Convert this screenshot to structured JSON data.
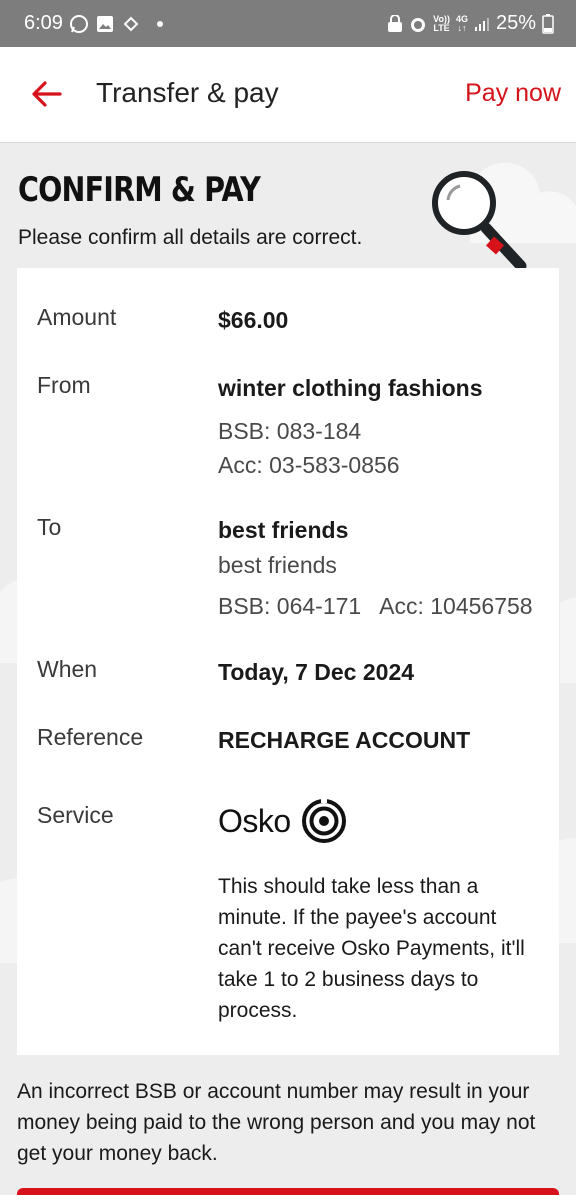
{
  "status_bar": {
    "time": "6:09",
    "network_top": "Vo))",
    "network_bottom": "LTE",
    "network_type_top": "4G",
    "network_type_bottom": "↓↑",
    "battery": "25%"
  },
  "header": {
    "title": "Transfer & pay",
    "action_label": "Pay now"
  },
  "page": {
    "heading": "CONFIRM & PAY",
    "subheading": "Please confirm all details are correct."
  },
  "details": {
    "amount_label": "Amount",
    "amount_value": "$66.00",
    "from_label": "From",
    "from_name": "winter clothing fashions",
    "from_bsb": "BSB: 083-184",
    "from_acc": "Acc: 03-583-0856",
    "to_label": "To",
    "to_name": "best friends",
    "to_nickname": "best friends",
    "to_account": "BSB: 064-171   Acc: 10456758",
    "when_label": "When",
    "when_value": "Today, 7 Dec 2024",
    "reference_label": "Reference",
    "reference_value": "RECHARGE ACCOUNT",
    "service_label": "Service",
    "service_name": "Osko",
    "service_description": "This should take less than a minute. If the payee's account can't receive Osko Payments, it'll take 1 to 2 business days to process."
  },
  "warning": "An incorrect BSB or account number may result in your money being paid to the wrong person and you may not get your money back.",
  "colors": {
    "brand_red": "#d6131b",
    "background": "#ededed",
    "status_bar": "#7d7d7d"
  },
  "icons": {
    "back": "arrow-left-icon",
    "magnifier": "magnifier-icon",
    "osko": "osko-logo-icon"
  }
}
